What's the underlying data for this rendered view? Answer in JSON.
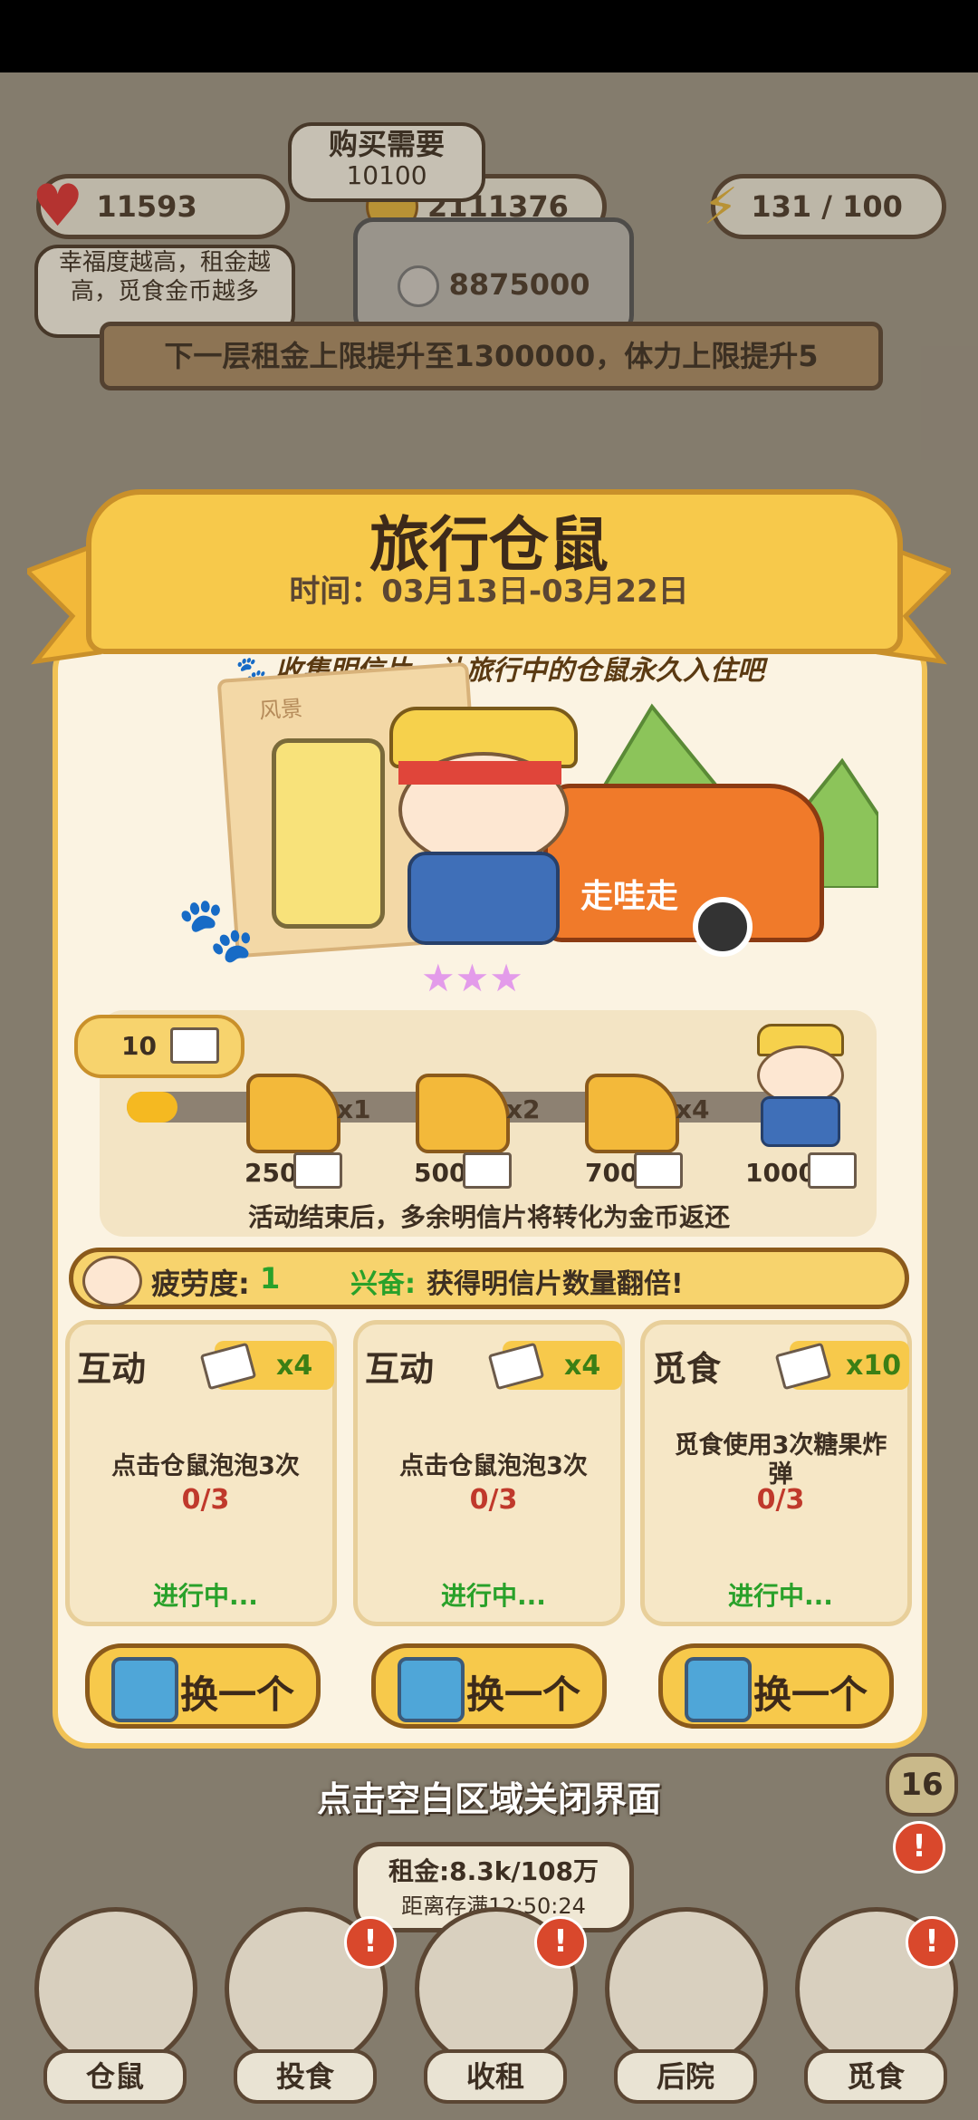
{
  "hud": {
    "hearts": "11593",
    "coins": "2111376",
    "energy": "131 / 100",
    "buy_need_label": "购买需要",
    "buy_need_value": "10100",
    "happiness_tip": "幸福度越高，租金越高，觅食金币越多",
    "price_value": "8875000",
    "next_floor_text": "下一层租金上限提升至1300000，体力上限提升5"
  },
  "event": {
    "title": "旅行仓鼠",
    "date": "时间：03月13日-03月22日",
    "tagline": "收集明信片，让旅行中的仓鼠永久入住吧",
    "postcard_label": "风景",
    "bus_label": "走哇走",
    "postcard_count": "10",
    "milestones": [
      {
        "value": "250",
        "mult": "x1"
      },
      {
        "value": "500",
        "mult": "x2"
      },
      {
        "value": "700",
        "mult": "x4"
      },
      {
        "value": "1000",
        "mult": ""
      }
    ],
    "progress_fraction": 0.01,
    "end_note": "活动结束后，多余明信片将转化为金币返还",
    "fatigue_label": "疲劳度:",
    "fatigue_value": "1",
    "excite_label": "兴奋:",
    "excite_text": "获得明信片数量翻倍!"
  },
  "tasks": [
    {
      "type": "互动",
      "reward": "x4",
      "desc": "点击仓鼠泡泡3次",
      "progress": "0/3",
      "status": "进行中..."
    },
    {
      "type": "互动",
      "reward": "x4",
      "desc": "点击仓鼠泡泡3次",
      "progress": "0/3",
      "status": "进行中..."
    },
    {
      "type": "觅食",
      "reward": "x10",
      "desc": "觅食使用3次糖果炸弹",
      "progress": "0/3",
      "status": "进行中..."
    }
  ],
  "swap_label": "换一个",
  "close_hint": "点击空白区域关闭界面",
  "side_count": "16",
  "rent": {
    "line1": "租金:8.3k/108万",
    "line2": "距离存满12:50:24"
  },
  "nav": [
    "仓鼠",
    "投食",
    "收租",
    "后院",
    "觅食"
  ],
  "colors": {
    "accent": "#f7c94b",
    "progress_red": "#c0392b",
    "status_green": "#29a12a"
  }
}
